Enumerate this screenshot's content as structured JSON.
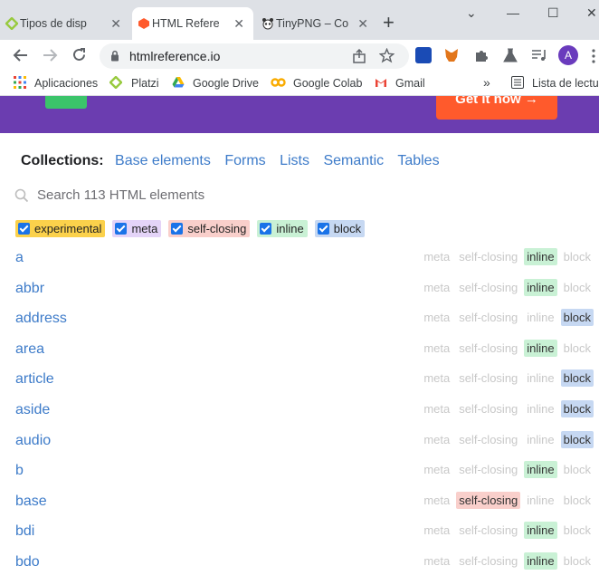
{
  "browser": {
    "tabs": [
      {
        "label": "Tipos de disp",
        "close": "✕"
      },
      {
        "label": "HTML Refere",
        "close": "✕"
      },
      {
        "label": "TinyPNG – Co",
        "close": "✕"
      }
    ],
    "new_tab": "+",
    "window_controls": [
      "⌄",
      "—",
      "☐",
      "✕"
    ],
    "url": "htmlreference.io",
    "avatar_letter": "A",
    "bookmarks": [
      "Aplicaciones",
      "Platzi",
      "Google Drive",
      "Google Colab",
      "Gmail"
    ],
    "bookmarks_more": "»",
    "reading_list": "Lista de lectura"
  },
  "promo": {
    "cta": "Get it now →"
  },
  "collections": {
    "title": "Collections:",
    "links": [
      "Base elements",
      "Forms",
      "Lists",
      "Semantic",
      "Tables"
    ]
  },
  "search": {
    "placeholder": "Search 113 HTML elements"
  },
  "filters": [
    {
      "label": "experimental",
      "color": "#fbd14b"
    },
    {
      "label": "meta",
      "color": "#e4d4f8"
    },
    {
      "label": "self-closing",
      "color": "#f9cfcb"
    },
    {
      "label": "inline",
      "color": "#c9f1d5"
    },
    {
      "label": "block",
      "color": "#c6d8f2"
    }
  ],
  "badge_labels": {
    "meta": "meta",
    "self": "self-closing",
    "inline": "inline",
    "block": "block"
  },
  "elements": [
    {
      "name": "a",
      "active": "inline"
    },
    {
      "name": "abbr",
      "active": "inline"
    },
    {
      "name": "address",
      "active": "block"
    },
    {
      "name": "area",
      "active": "inline"
    },
    {
      "name": "article",
      "active": "block"
    },
    {
      "name": "aside",
      "active": "block"
    },
    {
      "name": "audio",
      "active": "block"
    },
    {
      "name": "b",
      "active": "inline"
    },
    {
      "name": "base",
      "active": "self"
    },
    {
      "name": "bdi",
      "active": "inline"
    },
    {
      "name": "bdo",
      "active": "inline"
    }
  ]
}
